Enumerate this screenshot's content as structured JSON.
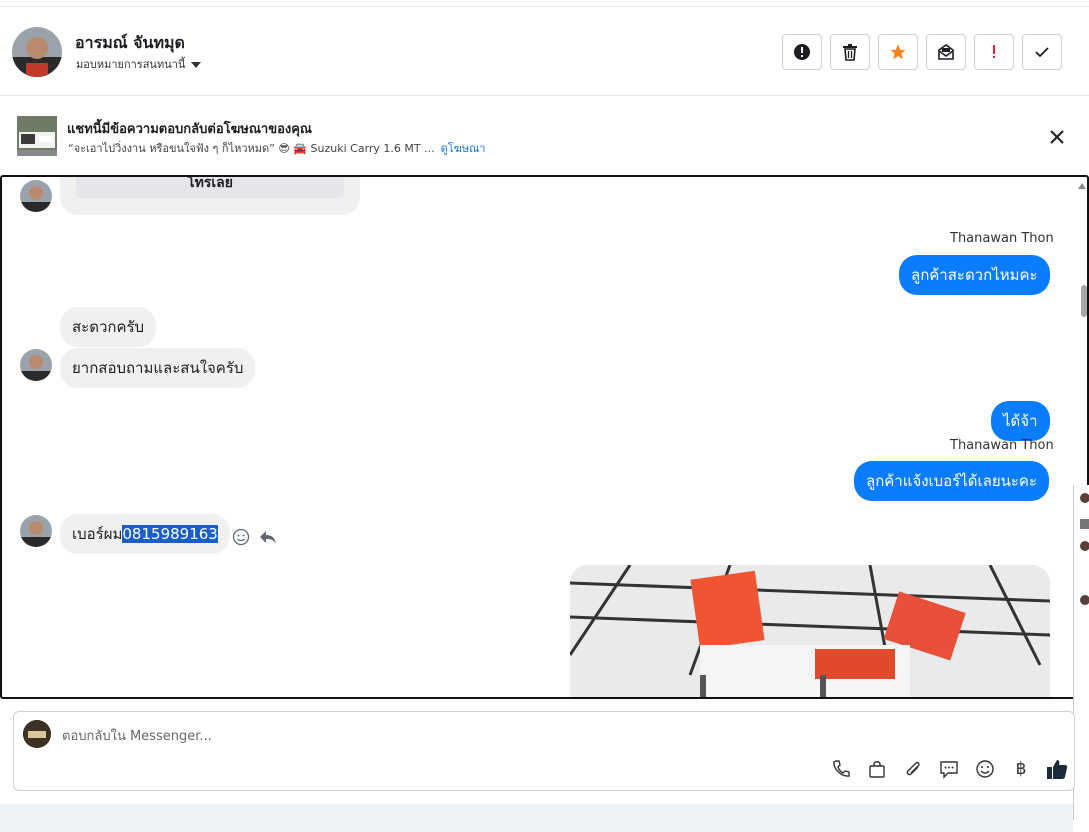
{
  "header": {
    "contact_name": "อารมณ์ จันทมุด",
    "assign_label": "มอบหมายการสนทนานี้",
    "actions": [
      {
        "name": "spam-button",
        "icon": "alert-circle-icon"
      },
      {
        "name": "delete-button",
        "icon": "trash-icon"
      },
      {
        "name": "star-button",
        "icon": "star-icon",
        "color": "#f5821f"
      },
      {
        "name": "mark-unread-button",
        "icon": "envelope-open-icon"
      },
      {
        "name": "follow-up-button",
        "icon": "exclamation-icon",
        "color": "#e41e3f"
      },
      {
        "name": "done-button",
        "icon": "check-icon"
      }
    ]
  },
  "ad": {
    "title": "แชทนี้มีข้อความตอบกลับต่อโฆษณาของคุณ",
    "subtitle": "“จะเอาไปวิ่งงาน หรือขนใจฟัง ๆ ก็ไหวหมด” 😎 🚘 Suzuki Carry 1.6 MT ...",
    "view_ad": "ดูโฆษณา"
  },
  "messages": {
    "card_button": "โทรเลย",
    "sender1": "Thanawan Thon",
    "out1": "ลูกค้าสะดวกไหมคะ",
    "in1": "สะดวกครับ",
    "in2": "ยากสอบถามและสนใจครับ",
    "out2": "ได้จ้า",
    "sender2": "Thanawan Thon",
    "out3": "ลูกค้าแจ้งเบอร์ได้เลยนะคะ",
    "in3_prefix": "เบอร์ผม",
    "in3_phone": "0815989163"
  },
  "reply": {
    "placeholder": "ตอบกลับใน Messenger...",
    "tools": [
      "phone-icon",
      "shopping-bag-icon",
      "paperclip-icon",
      "chat-bubble-icon",
      "smiley-icon",
      "baht-icon",
      "thumbs-up-icon"
    ],
    "baht_symbol": "฿"
  },
  "colors": {
    "accent_blue": "#0a7cff",
    "star_orange": "#f5821f",
    "alert_red": "#e41e3f"
  }
}
